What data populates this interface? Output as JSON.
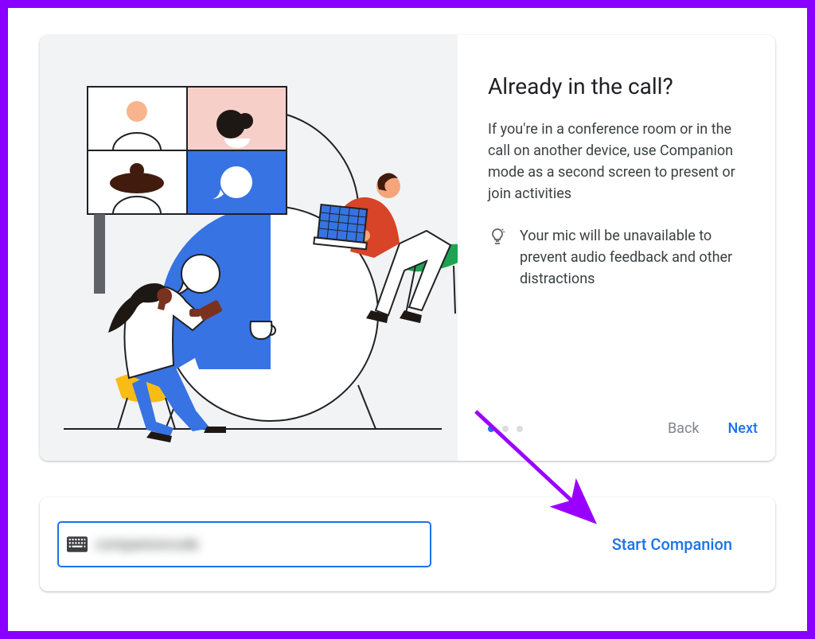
{
  "top": {
    "heading": "Already in the call?",
    "description": "If you're in a conference room or in the call on another device, use Companion mode as a second screen to present or join activities",
    "tip": "Your mic will be unavailable to prevent audio feedback and other distractions",
    "back_label": "Back",
    "next_label": "Next"
  },
  "bottom": {
    "input_value": "companioncode",
    "start_label": "Start Companion"
  }
}
